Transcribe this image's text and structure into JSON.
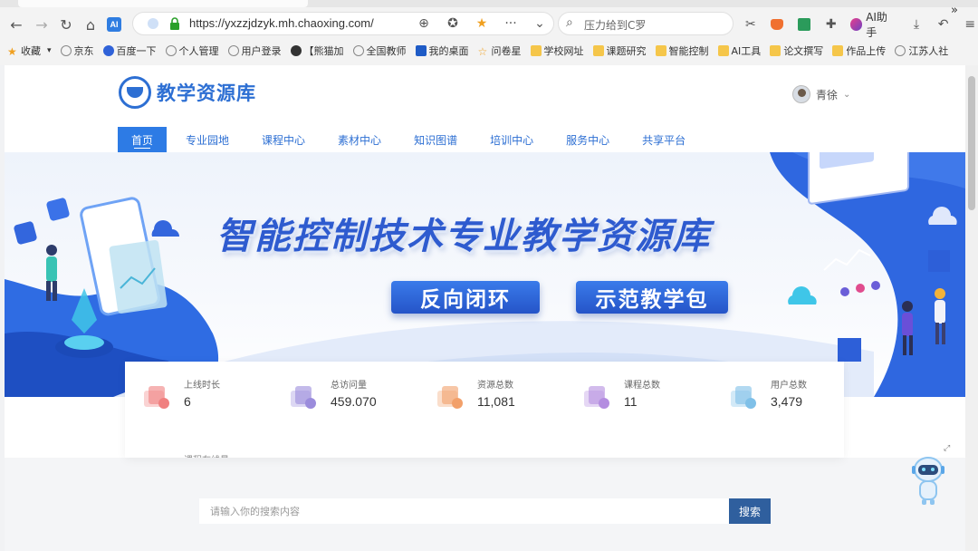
{
  "browser": {
    "url": "https://yxzzjdzyk.mh.chaoxing.com/",
    "search_placeholder": "压力给到C罗",
    "ai_helper": "AI助手",
    "bookmarks": [
      {
        "label": "收藏",
        "icon": "star-icon"
      },
      {
        "label": "京东",
        "icon": "globe-icon"
      },
      {
        "label": "百度一下",
        "icon": "baidu-icon"
      },
      {
        "label": "个人管理",
        "icon": "globe-icon"
      },
      {
        "label": "用户登录",
        "icon": "globe-icon"
      },
      {
        "label": "【熊猫加",
        "icon": "panda-icon"
      },
      {
        "label": "全国教师",
        "icon": "globe-icon"
      },
      {
        "label": "我的桌面",
        "icon": "app-icon"
      },
      {
        "label": "问卷星",
        "icon": "star-outline-icon"
      },
      {
        "label": "学校网址",
        "icon": "folder-icon"
      },
      {
        "label": "课题研究",
        "icon": "folder-icon"
      },
      {
        "label": "智能控制",
        "icon": "folder-icon"
      },
      {
        "label": "AI工具",
        "icon": "folder-icon"
      },
      {
        "label": "论文撰写",
        "icon": "folder-icon"
      },
      {
        "label": "作品上传",
        "icon": "folder-icon"
      },
      {
        "label": "江苏人社",
        "icon": "globe-icon"
      }
    ],
    "more": "»"
  },
  "site": {
    "logo_text": "教学资源库",
    "user_name": "青徐",
    "nav": [
      {
        "label": "首页",
        "active": true
      },
      {
        "label": "专业园地"
      },
      {
        "label": "课程中心"
      },
      {
        "label": "素材中心"
      },
      {
        "label": "知识图谱"
      },
      {
        "label": "培训中心"
      },
      {
        "label": "服务中心"
      },
      {
        "label": "共享平台"
      }
    ],
    "banner": {
      "title": "智能控制技术专业教学资源库",
      "pill_left": "反向闭环",
      "pill_right": "示范教学包"
    },
    "stats": [
      {
        "label": "上线时长",
        "value": "6",
        "icon": "duration-icon",
        "color": "#f08080"
      },
      {
        "label": "总访问量",
        "value": "459.070",
        "icon": "visits-icon",
        "color": "#9b8cdc"
      },
      {
        "label": "资源总数",
        "value": "11,081",
        "icon": "resources-icon",
        "color": "#f2a06a"
      },
      {
        "label": "课程总数",
        "value": "11",
        "icon": "courses-icon",
        "color": "#b48de0"
      },
      {
        "label": "用户总数",
        "value": "3,479",
        "icon": "users-icon",
        "color": "#7fc0e8"
      }
    ],
    "stats_row2_label": "课程在线量",
    "search": {
      "placeholder": "请输入你的搜索内容",
      "button": "搜索"
    }
  }
}
